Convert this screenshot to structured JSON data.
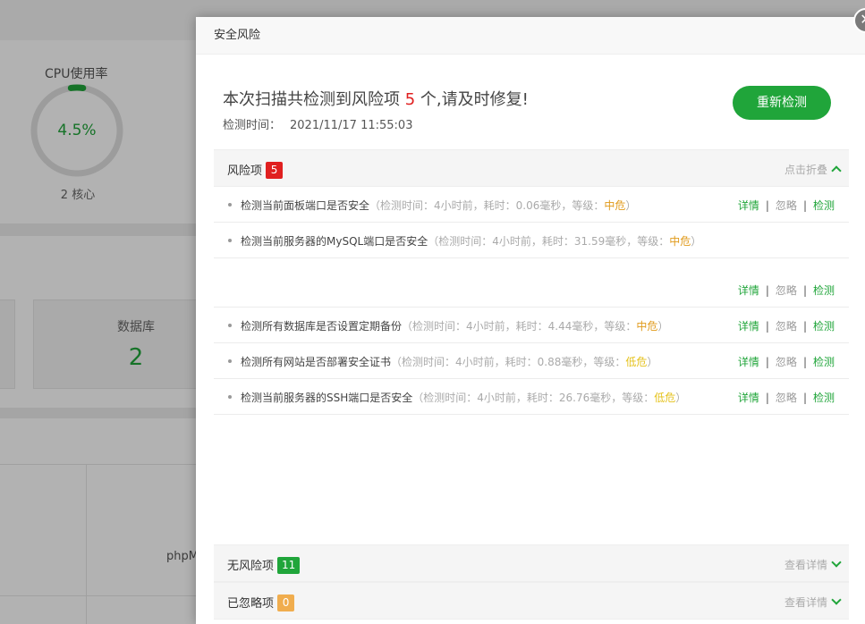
{
  "background": {
    "cpu": {
      "title": "CPU使用率",
      "value": "4.5%",
      "cores": "2 核心",
      "usage_fraction": 0.045
    },
    "database": {
      "label": "数据库",
      "value": "2"
    },
    "php_label": "phpM"
  },
  "modal": {
    "title": "安全风险",
    "close_icon": "close-icon",
    "summary": {
      "prefix": "本次扫描共检测到风险项",
      "count": "5",
      "suffix": "个,请及时修复!",
      "time_label": "检测时间：",
      "time_value": "2021/11/17 11:55:03"
    },
    "recheck_button": "重新检测",
    "risk_section": {
      "title": "风险项",
      "count": "5",
      "toggle": "点击折叠"
    },
    "risk_items": [
      {
        "text": "检测当前面板端口是否安全",
        "meta": "（检测时间：4小时前，耗时：0.06毫秒，等级：",
        "level": "中危",
        "level_type": "mid",
        "close": "）",
        "has_actions": true
      },
      {
        "text": "检测当前服务器的MySQL端口是否安全",
        "meta": "（检测时间：4小时前，耗时：31.59毫秒，等级：",
        "level": "中危",
        "level_type": "mid",
        "close": "）",
        "has_actions": false
      },
      {
        "text": "",
        "meta": "",
        "level": "",
        "level_type": "",
        "close": "",
        "has_actions": true
      },
      {
        "text": "检测所有数据库是否设置定期备份",
        "meta": "（检测时间：4小时前，耗时：4.44毫秒，等级：",
        "level": "中危",
        "level_type": "mid",
        "close": "）",
        "has_actions": true
      },
      {
        "text": "检测所有网站是否部署安全证书",
        "meta": "（检测时间：4小时前，耗时：0.88毫秒，等级：",
        "level": "低危",
        "level_type": "low",
        "close": "）",
        "has_actions": true
      },
      {
        "text": "检测当前服务器的SSH端口是否安全",
        "meta": "（检测时间：4小时前，耗时：26.76毫秒，等级：",
        "level": "低危",
        "level_type": "low",
        "close": "）",
        "has_actions": true
      }
    ],
    "actions": {
      "detail": "详情",
      "ignore": "忽略",
      "check": "检测",
      "separator": "|"
    },
    "safe_section": {
      "title": "无风险项",
      "count": "11",
      "toggle": "查看详情"
    },
    "ignored_section": {
      "title": "已忽略项",
      "count": "0",
      "toggle": "查看详情"
    },
    "colors": {
      "accent": "#20a53a",
      "danger": "#e02020",
      "mid": "#e09a1b",
      "low": "#e5c21c",
      "ignored_badge": "#f0ad4e"
    }
  }
}
